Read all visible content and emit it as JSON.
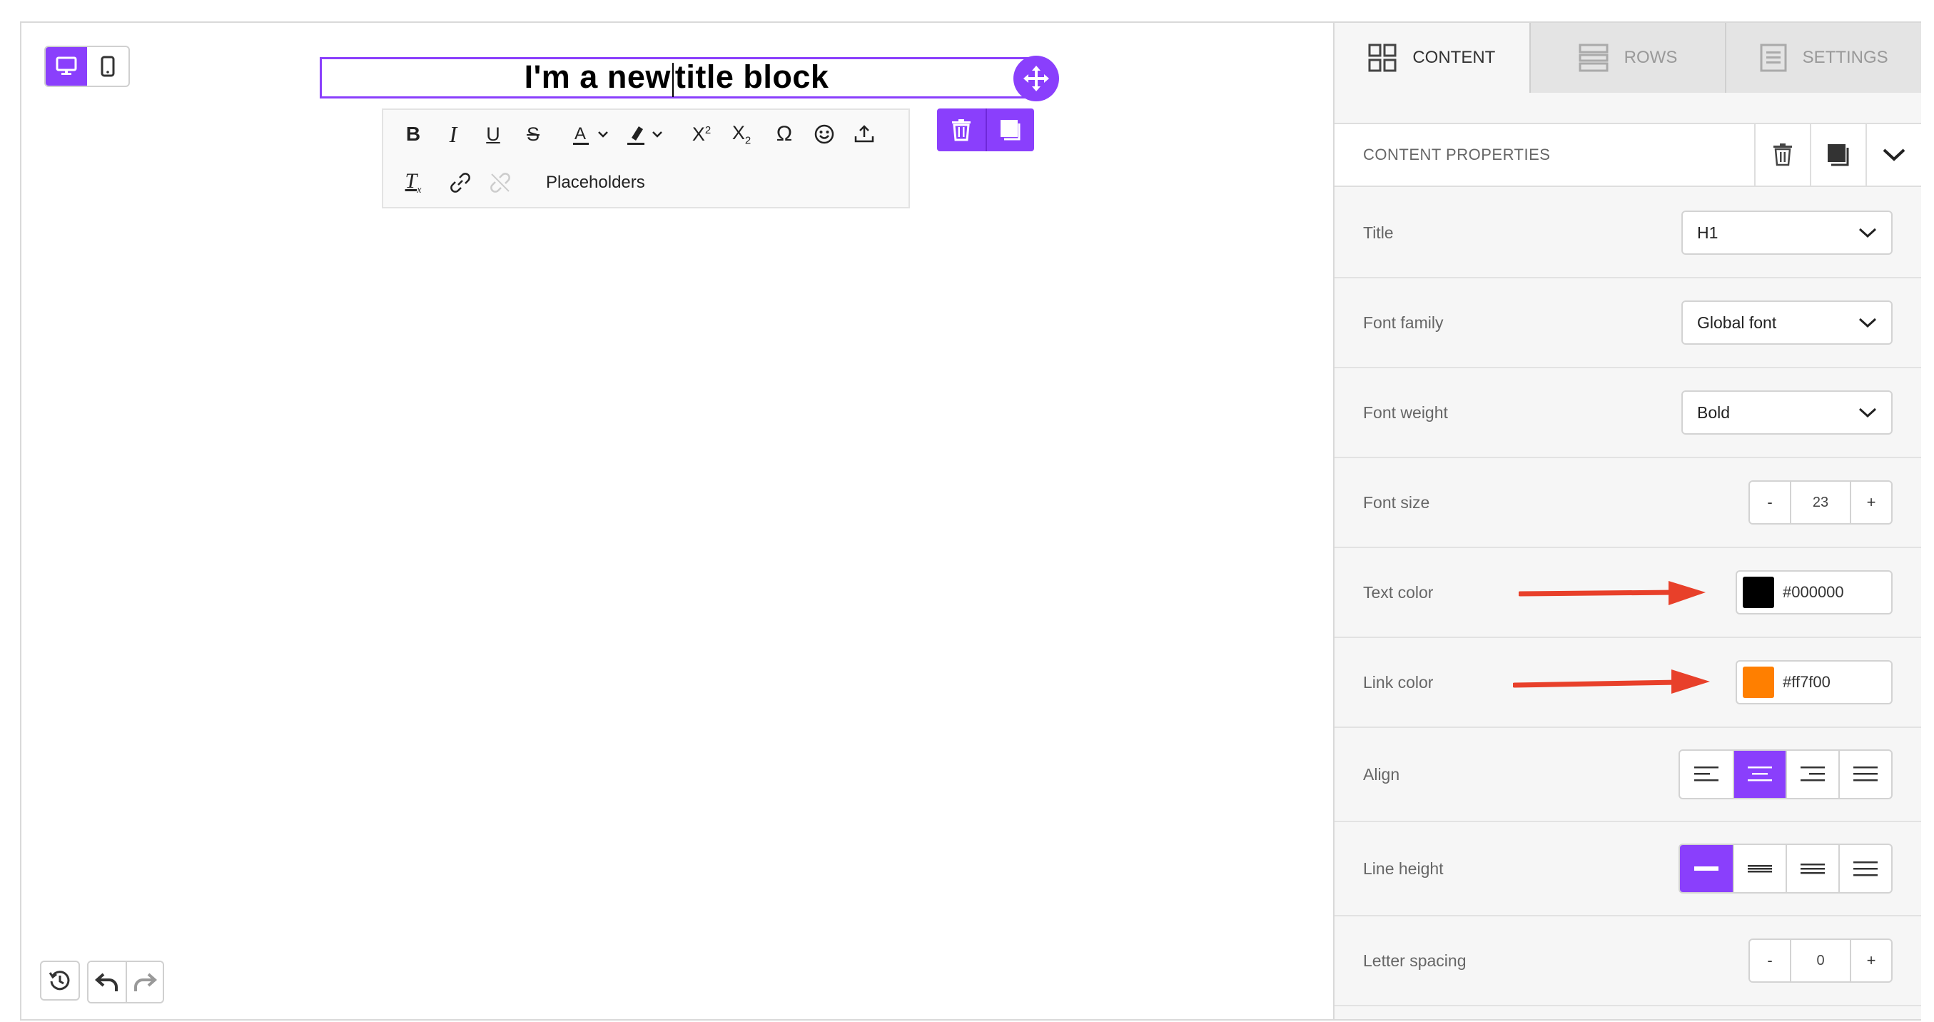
{
  "canvas": {
    "device_switch": {
      "desktop_icon": "desktop-icon",
      "mobile_icon": "mobile-icon",
      "active": "desktop"
    },
    "title_block": {
      "text_before_caret": "I'm a new",
      "text_after_caret": "title block"
    },
    "toolbar": {
      "row1": [
        "bold-icon",
        "italic-icon",
        "underline-icon",
        "strikethrough-icon",
        "text-color-icon",
        "highlight-icon",
        "superscript-icon",
        "subscript-icon",
        "special-char-icon",
        "emoji-icon",
        "upload-icon"
      ],
      "row2": [
        "clear-format-icon",
        "link-icon",
        "unlink-icon"
      ],
      "placeholders_label": "Placeholders"
    },
    "history": {
      "history_icon": "history-icon",
      "undo_icon": "undo-icon",
      "redo_icon": "redo-icon"
    }
  },
  "sidebar": {
    "tabs": [
      {
        "label": "CONTENT",
        "icon": "grid-icon",
        "active": true
      },
      {
        "label": "ROWS",
        "icon": "rows-icon",
        "active": false
      },
      {
        "label": "SETTINGS",
        "icon": "settings-icon",
        "active": false
      }
    ],
    "props_title": "CONTENT PROPERTIES",
    "properties": {
      "title": {
        "label": "Title",
        "value": "H1"
      },
      "font_family": {
        "label": "Font family",
        "value": "Global font"
      },
      "font_weight": {
        "label": "Font weight",
        "value": "Bold"
      },
      "font_size": {
        "label": "Font size",
        "value": "23",
        "minus": "-",
        "plus": "+"
      },
      "text_color": {
        "label": "Text color",
        "value": "#000000",
        "swatch": "#000000"
      },
      "link_color": {
        "label": "Link color",
        "value": "#ff7f00",
        "swatch": "#ff7f00"
      },
      "align": {
        "label": "Align",
        "active_index": 1
      },
      "line_height": {
        "label": "Line height",
        "active_index": 0
      },
      "letter_spacing": {
        "label": "Letter spacing",
        "value": "0",
        "minus": "-",
        "plus": "+"
      }
    }
  },
  "colors": {
    "accent": "#8a3ffc",
    "annotation_arrow": "#e8402a"
  }
}
